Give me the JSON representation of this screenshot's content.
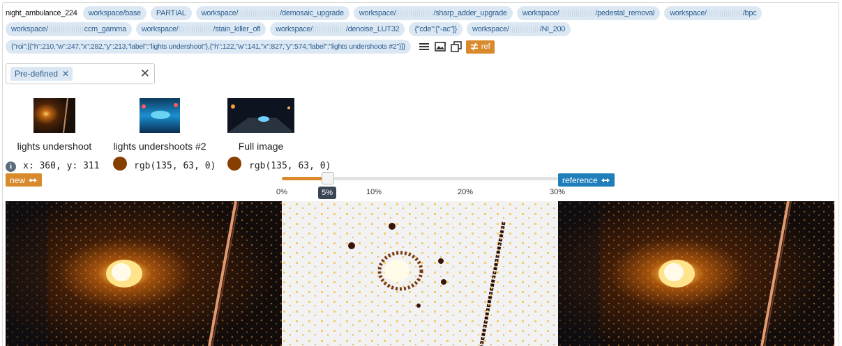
{
  "header": {
    "title": "night_ambulance_224",
    "chips_row1": [
      {
        "pre": "workspace/base",
        "post": ""
      },
      {
        "pre": "PARTIAL",
        "post": ""
      },
      {
        "pre": "workspace/",
        "post": "/demosaic_upgrade"
      },
      {
        "pre": "workspace/",
        "post": "/sharp_adder_upgrade"
      },
      {
        "pre": "workspace/",
        "post": "/pedestal_removal"
      },
      {
        "pre": "workspace/",
        "post": "/bpc"
      }
    ],
    "chips_row2": [
      {
        "pre": "workspace/",
        "post": "ccm_gamma"
      },
      {
        "pre": "workspace/",
        "post": "/stain_killer_ofl"
      },
      {
        "pre": "workspace/",
        "post": "/denoise_LUT32"
      },
      {
        "pre": "{\"cde\":[\"-ac\"]}",
        "post": ""
      },
      {
        "pre": "workspace/",
        "post": "/NI_200"
      }
    ],
    "roi_chip": "{\"roi\":[{\"h\":210,\"w\":247,\"x\":282,\"y\":213,\"label\":\"lights undershoot\"},{\"h\":122,\"w\":141,\"x\":827,\"y\":574,\"label\":\"lights undershoots #2\"}]}",
    "tools": {
      "list_icon": "list-icon",
      "swap_image_icon": "swap-image-icon",
      "copy_icon": "copy-icon",
      "ref_button_label": "ref",
      "ref_button_icon": "not-equal-icon"
    }
  },
  "filter": {
    "chip_label": "Pre-defined",
    "chip_remove_icon": "close-icon",
    "clear_icon": "close-icon"
  },
  "thumbnails": [
    {
      "label": "lights undershoot"
    },
    {
      "label": "lights undershoots #2"
    },
    {
      "label": "Full image"
    }
  ],
  "pixel_info": {
    "coord_text": "x: 360, y: 311",
    "new_rgb": "rgb(135, 63, 0)",
    "ref_rgb": "rgb(135, 63, 0)",
    "swatch_color": "#873f00"
  },
  "buttons": {
    "new_label": "new",
    "reference_label": "reference"
  },
  "slider": {
    "value_label": "5%",
    "value_fraction": 0.167,
    "ticks": [
      "0%",
      "10%",
      "20%",
      "30%"
    ]
  },
  "colors": {
    "chip_bg": "#dbe8f4",
    "chip_text": "#2f5e8d",
    "accent_orange": "#d98a2c",
    "accent_blue": "#1e7fba"
  }
}
